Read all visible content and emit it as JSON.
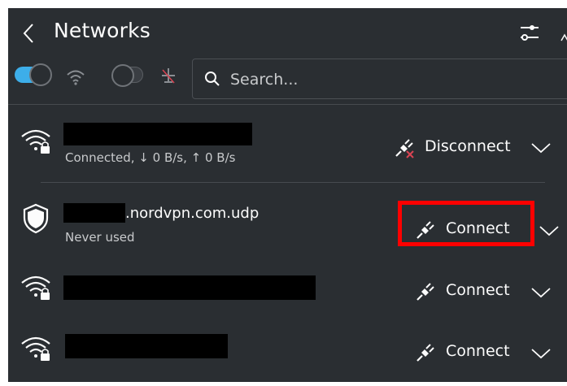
{
  "header": {
    "title": "Networks"
  },
  "search": {
    "placeholder": "Search..."
  },
  "connections": [
    {
      "status": "Connected, ↓ 0 B/s, ↑ 0 B/s",
      "action": "Disconnect",
      "icon": "wifi-locked-icon"
    },
    {
      "name_suffix": ".nordvpn.com.udp",
      "status": "Never used",
      "action": "Connect",
      "icon": "vpn-shield-icon"
    },
    {
      "action": "Connect",
      "icon": "wifi-locked-icon"
    },
    {
      "action": "Connect",
      "icon": "wifi-locked-icon"
    }
  ],
  "colors": {
    "background": "#2a2e32",
    "accent": "#3daee9",
    "highlight": "#ff0000",
    "disconnect_mark": "#da4453"
  }
}
